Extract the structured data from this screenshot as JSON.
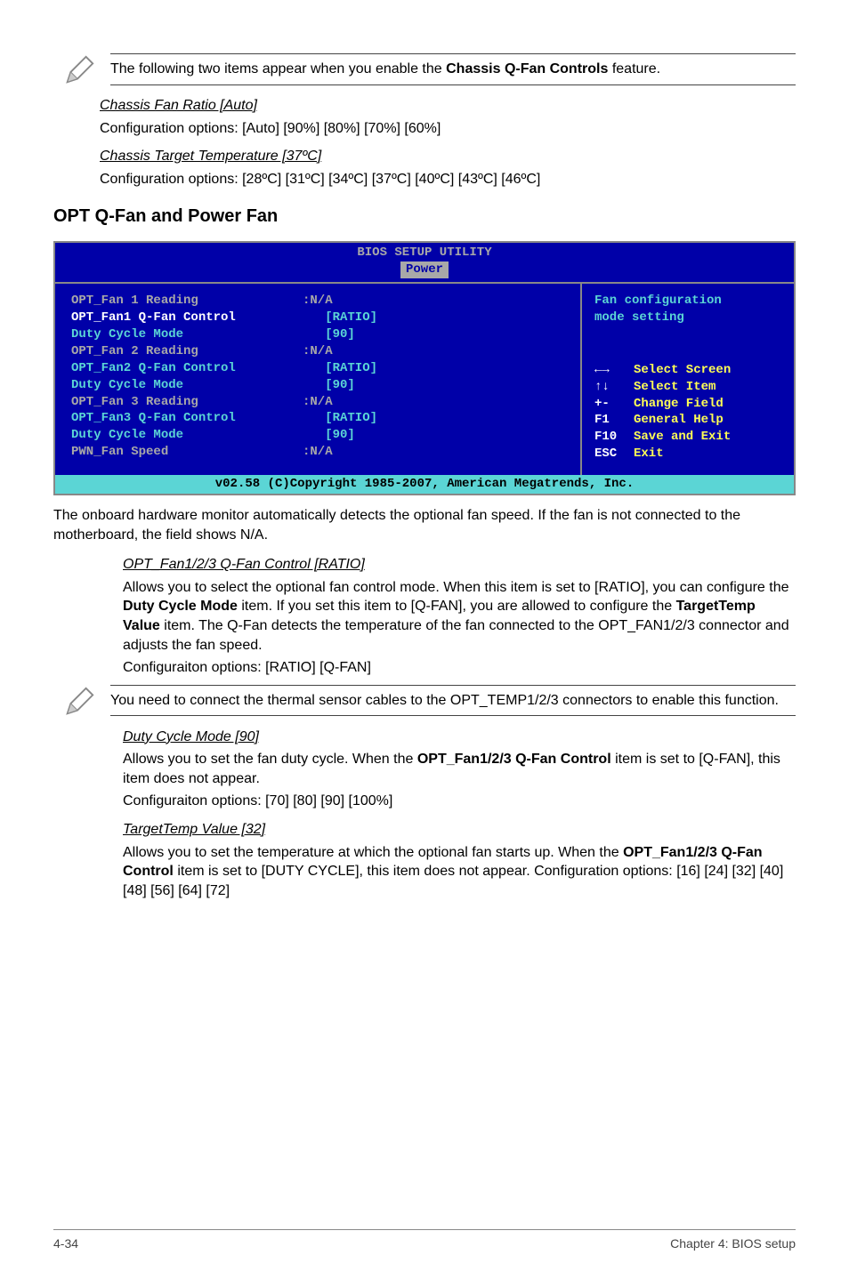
{
  "note1": {
    "text_a": "The following two items appear when you enable the ",
    "bold": "Chassis Q-Fan Controls",
    "text_b": " feature."
  },
  "chassis_ratio": {
    "title": "Chassis Fan Ratio [Auto]",
    "body": "Configuration options: [Auto] [90%] [80%] [70%] [60%]"
  },
  "chassis_temp": {
    "title": "Chassis Target Temperature [37ºC]",
    "body": "Configuration options: [28ºC] [31ºC] [34ºC] [37ºC] [40ºC] [43ºC] [46ºC]"
  },
  "section_title": "OPT Q-Fan and Power Fan",
  "bios": {
    "title": "BIOS SETUP UTILITY",
    "tab": "Power",
    "rows": [
      {
        "label": "OPT_Fan 1 Reading",
        "colon": ":",
        "value": "N/A",
        "vclass": "val-grey",
        "lclass": "val-grey"
      },
      {
        "label": "OPT_Fan1 Q-Fan Control",
        "colon": "",
        "value": "   [RATIO]",
        "vclass": "val-blue",
        "lclass": "val-key"
      },
      {
        "label": "Duty Cycle Mode",
        "colon": "",
        "value": "   [90]",
        "vclass": "val-blue",
        "lclass": "val-blue"
      },
      {
        "label": "OPT_Fan 2 Reading",
        "colon": ":",
        "value": "N/A",
        "vclass": "val-grey",
        "lclass": "val-grey"
      },
      {
        "label": "OPT_Fan2 Q-Fan Control",
        "colon": "",
        "value": "   [RATIO]",
        "vclass": "val-blue",
        "lclass": "val-blue"
      },
      {
        "label": "Duty Cycle Mode",
        "colon": "",
        "value": "   [90]",
        "vclass": "val-blue",
        "lclass": "val-blue"
      },
      {
        "label": "OPT_Fan 3 Reading",
        "colon": ":",
        "value": "N/A",
        "vclass": "val-grey",
        "lclass": "val-grey"
      },
      {
        "label": "OPT_Fan3 Q-Fan Control",
        "colon": "",
        "value": "   [RATIO]",
        "vclass": "val-blue",
        "lclass": "val-blue"
      },
      {
        "label": "Duty Cycle Mode",
        "colon": "",
        "value": "   [90]",
        "vclass": "val-blue",
        "lclass": "val-blue"
      },
      {
        "label": "",
        "colon": "",
        "value": "",
        "vclass": "",
        "lclass": ""
      },
      {
        "label": "PWN_Fan Speed",
        "colon": ":",
        "value": "N/A",
        "vclass": "val-grey",
        "lclass": "val-grey"
      }
    ],
    "help_title_a": "Fan configuration",
    "help_title_b": "mode setting",
    "help": [
      {
        "k": "←→",
        "d": "Select Screen",
        "arrow": true
      },
      {
        "k": "↑↓",
        "d": "Select Item",
        "arrow": true
      },
      {
        "k": "+-",
        "d": "Change Field"
      },
      {
        "k": "F1",
        "d": "General Help"
      },
      {
        "k": "F10",
        "d": "Save and Exit"
      },
      {
        "k": "ESC",
        "d": "Exit"
      }
    ],
    "footer": "v02.58 (C)Copyright 1985-2007, American Megatrends, Inc."
  },
  "after_bios": "The onboard hardware monitor automatically detects the optional fan speed. If the fan is not connected to the motherboard, the field shows N/A.",
  "opt_qfan": {
    "title": "OPT_Fan1/2/3 Q-Fan Control [RATIO]",
    "p1a": "Allows you to select the optional fan control mode. When this item is set to [RATIO], you can configure the ",
    "p1b": "Duty Cycle Mode",
    "p1c": " item. If you set this item to [Q-FAN], you are allowed to configure the ",
    "p1d": "TargetTemp Value",
    "p1e": " item. The Q-Fan detects the temperature of the fan connected to the OPT_FAN1/2/3 connector and adjusts the fan speed.",
    "p2": "Configuraiton options: [RATIO] [Q-FAN]"
  },
  "note2": "You need to connect the thermal sensor cables to the OPT_TEMP1/2/3 connectors to enable this function.",
  "duty": {
    "title": "Duty Cycle Mode [90]",
    "p1a": "Allows you to set the fan duty cycle. When the ",
    "p1b": "OPT_Fan1/2/3 Q-Fan Control",
    "p1c": " item is set to [Q-FAN], this item does not appear.",
    "p2": "Configuraiton options: [70] [80] [90] [100%]"
  },
  "target": {
    "title": "TargetTemp Value [32]",
    "p1a": "Allows you to set the temperature at which the optional fan starts up. When the ",
    "p1b": "OPT_Fan1/2/3 Q-Fan Control",
    "p1c": " item is set to [DUTY CYCLE], this item does not appear. Configuration options: [16] [24] [32] [40] [48] [56] [64] [72]"
  },
  "footer": {
    "left": "4-34",
    "right": "Chapter 4: BIOS setup"
  }
}
